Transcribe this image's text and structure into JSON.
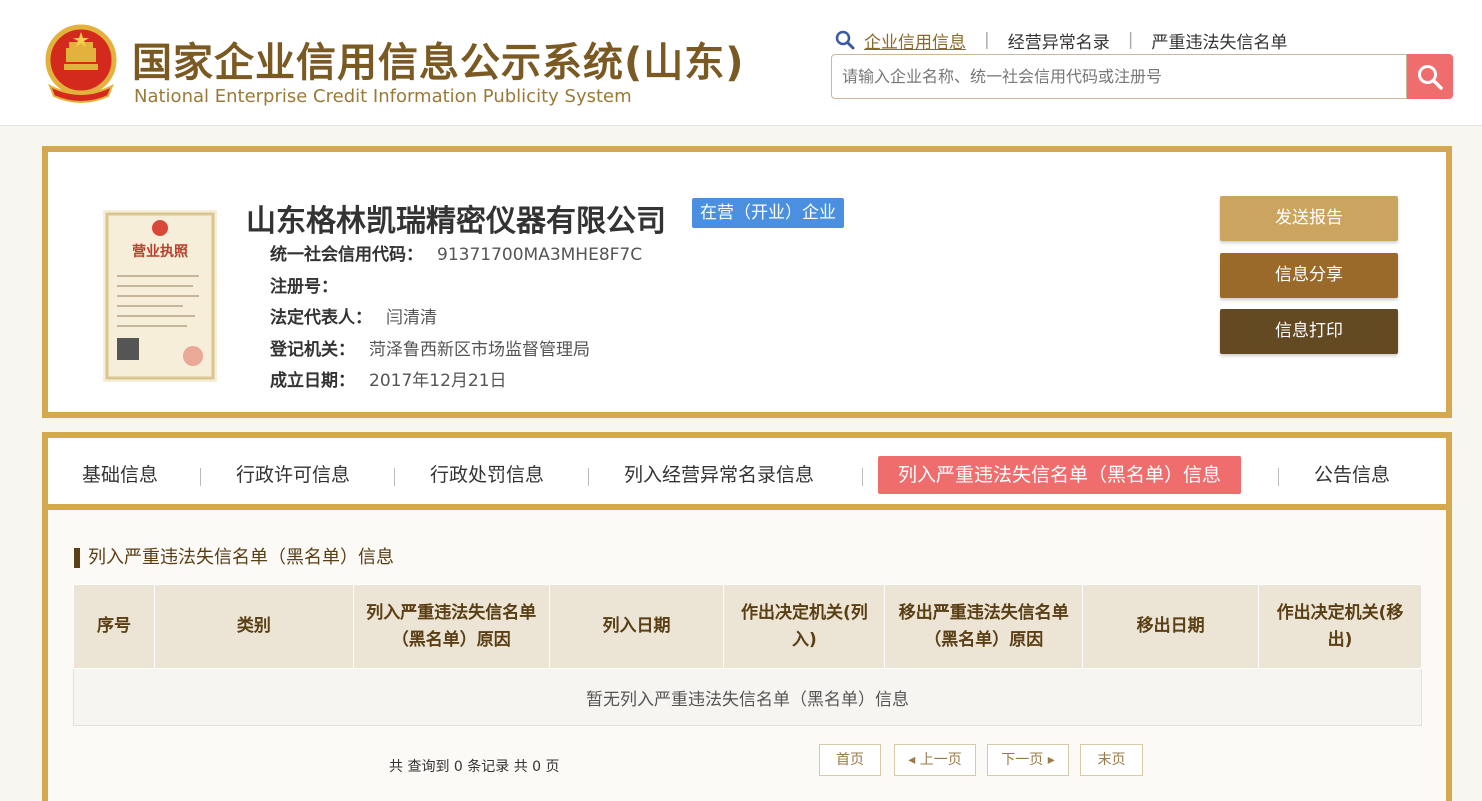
{
  "header": {
    "logo_cn": "国家企业信用信息公示系统(山东)",
    "logo_en": "National Enterprise Credit Information Publicity System",
    "nav": [
      {
        "label": "企业信用信息",
        "active": true
      },
      {
        "label": "经营异常名录",
        "active": false
      },
      {
        "label": "严重违法失信名单",
        "active": false
      }
    ],
    "search_placeholder": "请输入企业名称、统一社会信用代码或注册号"
  },
  "company": {
    "name": "山东格林凯瑞精密仪器有限公司",
    "status_badge": "在营（开业）企业",
    "fields": [
      {
        "label": "统一社会信用代码：",
        "value": "91371700MA3MHE8F7C"
      },
      {
        "label": "注册号：",
        "value": ""
      },
      {
        "label": "法定代表人：",
        "value": "闫清清"
      },
      {
        "label": "登记机关：",
        "value": "菏泽鲁西新区市场监督管理局"
      },
      {
        "label": "成立日期：",
        "value": "2017年12月21日"
      }
    ],
    "license_title": "营业执照",
    "actions": {
      "send": "发送报告",
      "share": "信息分享",
      "print": "信息打印"
    }
  },
  "tabs": [
    {
      "label": "基础信息",
      "active": false
    },
    {
      "label": "行政许可信息",
      "active": false
    },
    {
      "label": "行政处罚信息",
      "active": false
    },
    {
      "label": "列入经营异常名录信息",
      "active": false
    },
    {
      "label": "列入严重违法失信名单（黑名单）信息",
      "active": true
    },
    {
      "label": "公告信息",
      "active": false
    }
  ],
  "section": {
    "title": "列入严重违法失信名单（黑名单）信息",
    "columns": [
      "序号",
      "类别",
      "列入严重违法失信名单（黑名单）原因",
      "列入日期",
      "作出决定机关(列入)",
      "移出严重违法失信名单（黑名单）原因",
      "移出日期",
      "作出决定机关(移出)"
    ],
    "empty_text": "暂无列入严重违法失信名单（黑名单）信息"
  },
  "pagination": {
    "summary": "共 查询到 0 条记录 共 0 页",
    "first": "首页",
    "prev": "◂ 上一页",
    "next": "下一页 ▸",
    "last": "末页"
  },
  "colors": {
    "gold_border": "#d3a84e",
    "accent_red": "#ef6d6d",
    "status_blue": "#4a8fe0",
    "brand_brown": "#7a5a22"
  }
}
